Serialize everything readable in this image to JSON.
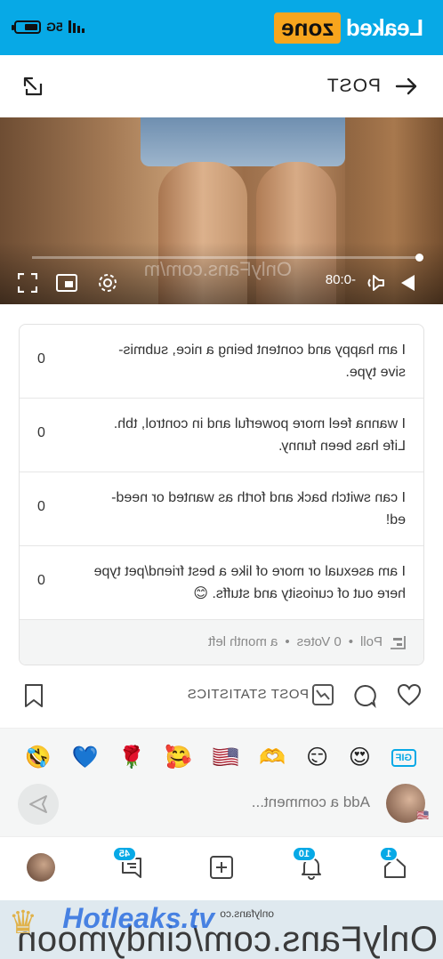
{
  "status_bar": {
    "brand_left": "Leaked",
    "brand_right": "zone",
    "network": "5G"
  },
  "header": {
    "title": "POST",
    "back_icon": "arrow-right-icon",
    "share_icon": "share-icon"
  },
  "video": {
    "watermark": "OnlyFans.com/m",
    "time_remaining": "-0:08",
    "progress_fraction": 0.0
  },
  "poll": {
    "options": [
      {
        "text": "I am happy and content being a nice, submis- sive type.",
        "votes": "0"
      },
      {
        "text": "I wanna feel more powerful and in control, tbh. Life has been funny.",
        "votes": "0"
      },
      {
        "text": "I can switch back and forth as wanted or need- ed!",
        "votes": "0"
      },
      {
        "text": "I am asexual or more of like a best friend/pet type here out of curiosity and stuffs. 😊",
        "votes": "0"
      }
    ],
    "footer": {
      "label": "Poll",
      "votes": "0 Votes",
      "expiry": "a month left",
      "sep": "•"
    }
  },
  "actions": {
    "stats_label": "POST STATISTICS"
  },
  "emoji_bar": {
    "emojis": [
      "🤣",
      "💙",
      "🌹",
      "🥰",
      "🇺🇸",
      "🫶",
      "😏",
      "😍"
    ],
    "gif_label": "GIF"
  },
  "comment": {
    "placeholder": "Add a comment..."
  },
  "nav": {
    "home_badge": "1",
    "notifications_badge": "10",
    "messages_badge": "45"
  },
  "url_bar": {
    "url": "onlyfans.co",
    "watermark": "OnlyFans.com/cindymoon",
    "hotleaks": "Hotleaks.tv"
  },
  "colors": {
    "accent": "#07a9e6",
    "brand_orange": "#f7a51d"
  }
}
